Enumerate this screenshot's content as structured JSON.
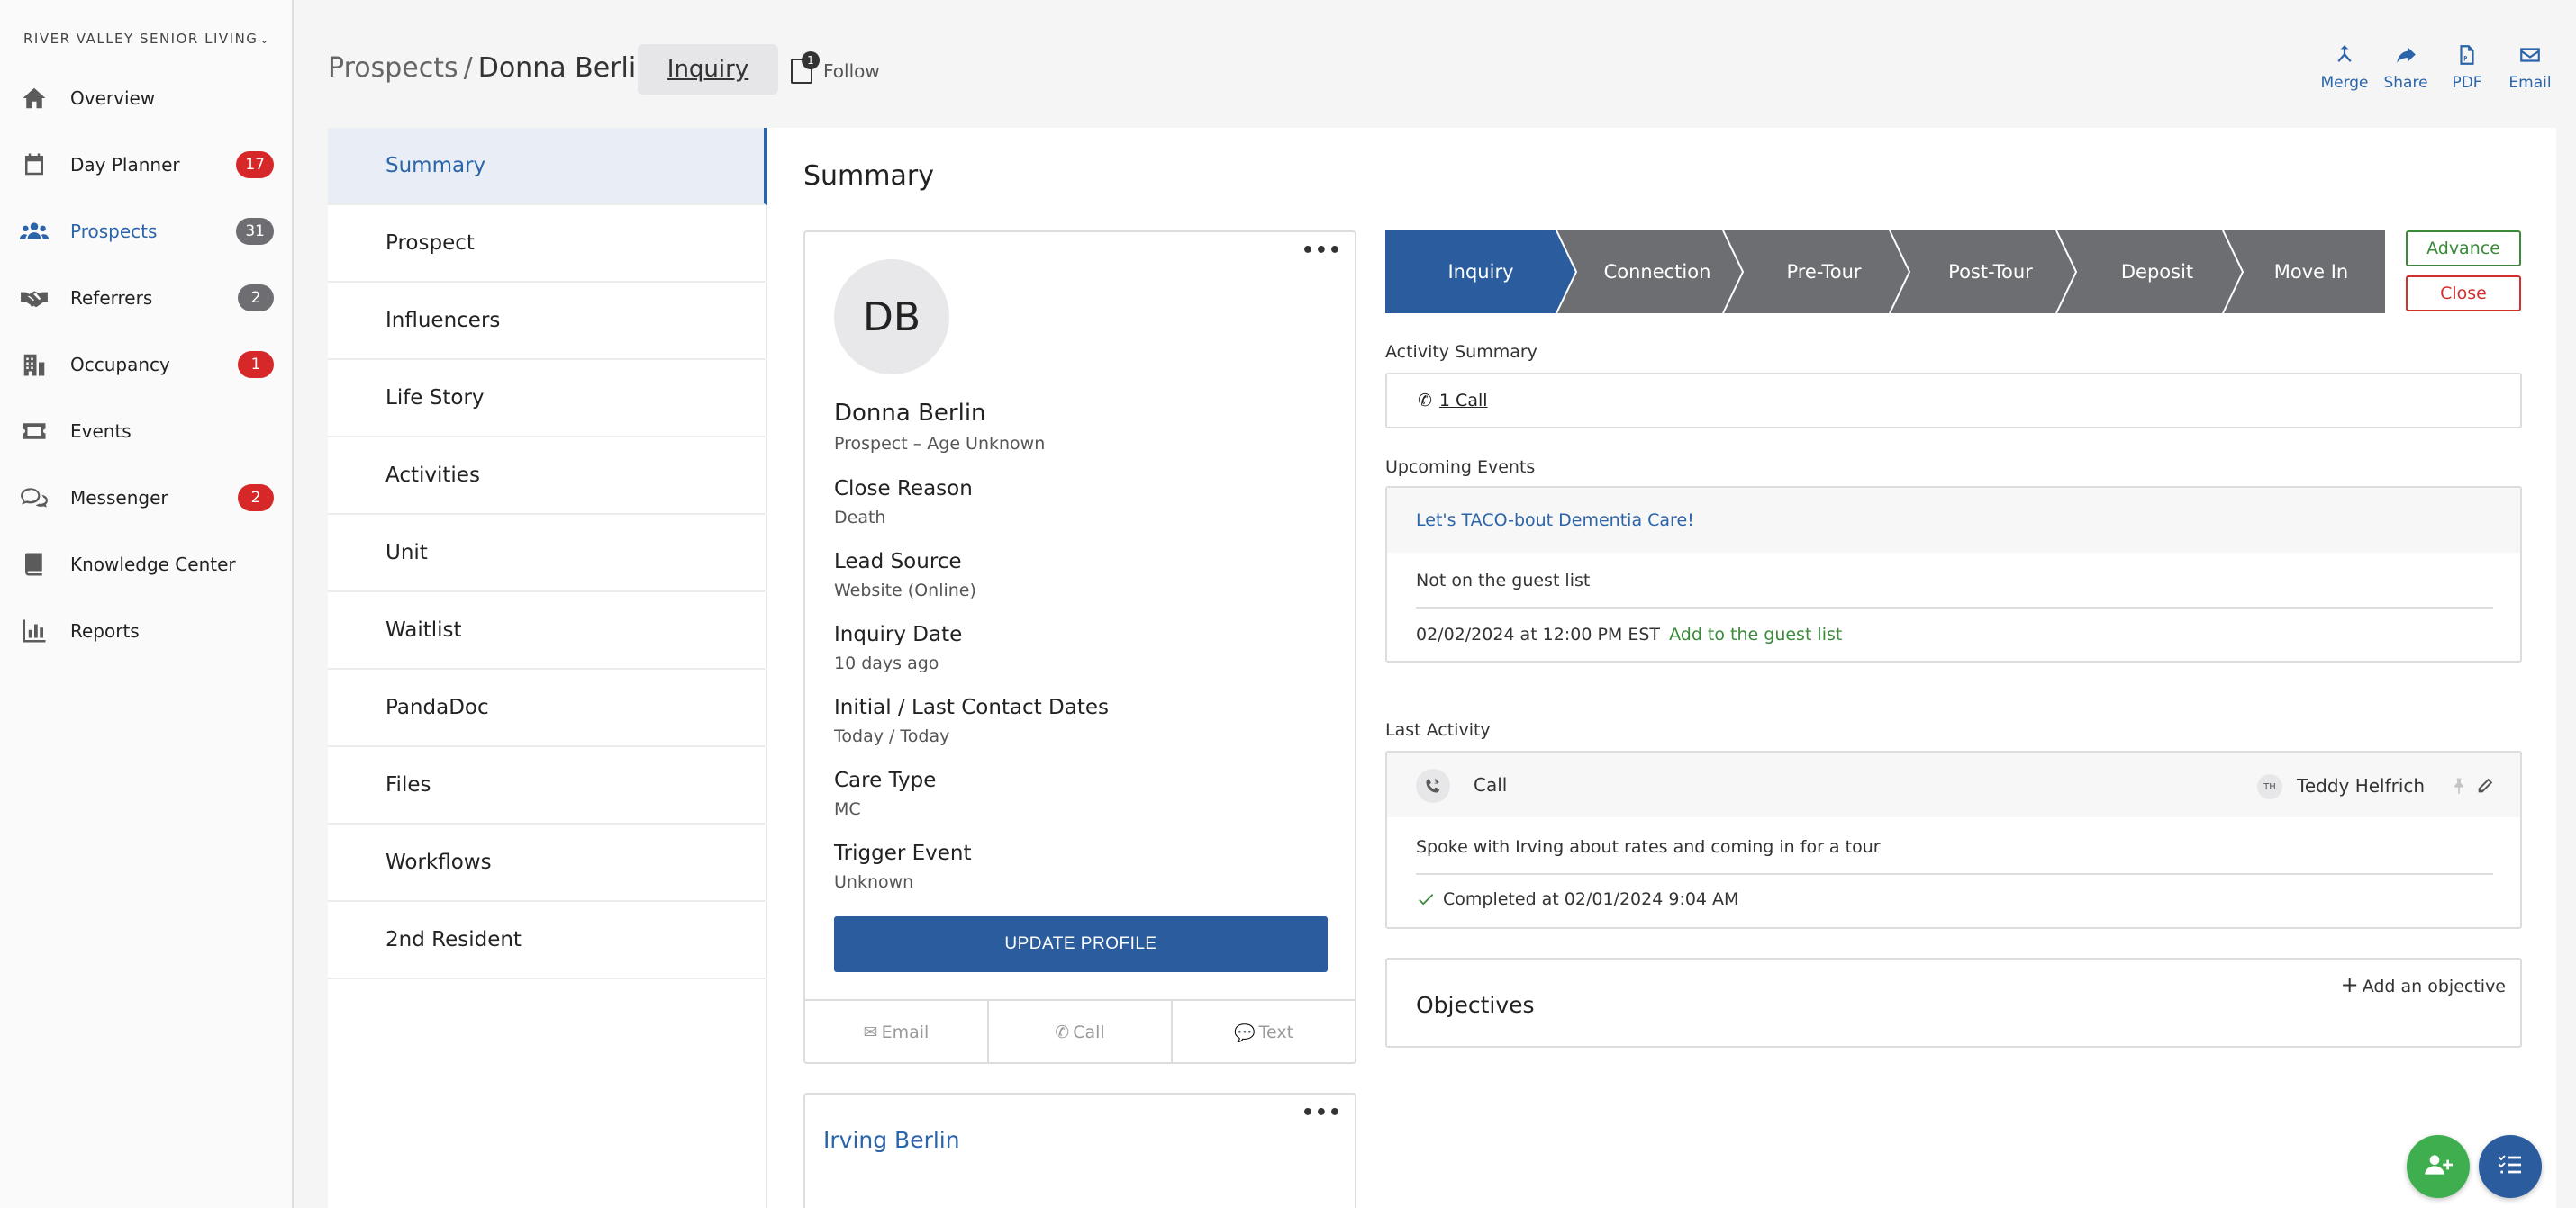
{
  "org": {
    "name": "RIVER VALLEY SENIOR LIVING",
    "chevron": "⌄"
  },
  "nav": [
    {
      "label": "Overview",
      "icon": "home-icon",
      "badge": ""
    },
    {
      "label": "Day Planner",
      "icon": "calendar-icon",
      "badge": "17",
      "badge_color": "#d62828"
    },
    {
      "label": "Prospects",
      "icon": "people-icon",
      "badge": "31",
      "badge_color": "#6e6e72",
      "active": true
    },
    {
      "label": "Referrers",
      "icon": "handshake-icon",
      "badge": "2",
      "badge_color": "#6e6e72"
    },
    {
      "label": "Occupancy",
      "icon": "building-icon",
      "badge": "1",
      "badge_color": "#d62828"
    },
    {
      "label": "Events",
      "icon": "ticket-icon",
      "badge": ""
    },
    {
      "label": "Messenger",
      "icon": "chat-icon",
      "badge": "2",
      "badge_color": "#d62828"
    },
    {
      "label": "Knowledge Center",
      "icon": "book-icon",
      "badge": ""
    },
    {
      "label": "Reports",
      "icon": "bar-chart-icon",
      "badge": ""
    }
  ],
  "header": {
    "crumb_root": "Prospects",
    "crumb_sep": "/",
    "crumb_current": "Donna Berlin",
    "stage_pill": "Inquiry",
    "follow_label": "Follow",
    "follow_count": "1",
    "actions": [
      {
        "label": "Merge",
        "icon": "merge-icon"
      },
      {
        "label": "Share",
        "icon": "share-icon"
      },
      {
        "label": "PDF",
        "icon": "pdf-icon"
      },
      {
        "label": "Email",
        "icon": "envelope-icon"
      }
    ]
  },
  "tabs": [
    "Summary",
    "Prospect",
    "Influencers",
    "Life Story",
    "Activities",
    "Unit",
    "Waitlist",
    "PandaDoc",
    "Files",
    "Workflows",
    "2nd Resident"
  ],
  "summary": {
    "title": "Summary",
    "profile": {
      "initials": "DB",
      "name": "Donna Berlin",
      "subtitle": "Prospect – Age Unknown",
      "fields": [
        {
          "label": "Close Reason",
          "value": "Death"
        },
        {
          "label": "Lead Source",
          "value": "Website (Online)"
        },
        {
          "label": "Inquiry Date",
          "value": "10 days ago"
        },
        {
          "label": "Initial / Last Contact Dates",
          "value": "Today / Today"
        },
        {
          "label": "Care Type",
          "value": "MC"
        },
        {
          "label": "Trigger Event",
          "value": "Unknown"
        }
      ],
      "update_button": "UPDATE PROFILE",
      "contact_email": "Email",
      "contact_call": "Call",
      "contact_text": "Text"
    },
    "second_card_name": "Irving Berlin",
    "stages": [
      "Inquiry",
      "Connection",
      "Pre-Tour",
      "Post-Tour",
      "Deposit",
      "Move In"
    ],
    "active_stage": "Inquiry",
    "advance_label": "Advance",
    "close_label": "Close",
    "activity_summary_label": "Activity Summary",
    "activity_link": "1 Call",
    "upcoming_label": "Upcoming Events",
    "event_title": "Let's TACO-bout Dementia Care!",
    "event_status": "Not on the guest list",
    "event_when": "02/02/2024 at 12:00 PM EST",
    "event_add": "Add to the guest list",
    "last_activity_label": "Last Activity",
    "last_activity": {
      "type": "Call",
      "user_initials": "TH",
      "user_name": "Teddy Helfrich",
      "note": "Spoke with Irving about rates and coming in for a tour",
      "completed": "Completed at 02/01/2024 9:04 AM"
    },
    "objectives_title": "Objectives",
    "objectives_add": "Add an objective"
  },
  "colors": {
    "accent": "#2b64a8",
    "stage_active": "#2b5d9e",
    "stage_inactive": "#6d6e72",
    "success": "#3a8a3a",
    "danger": "#d32f2f",
    "fab_green": "#3fae4f",
    "fab_blue": "#2b5d9e"
  }
}
